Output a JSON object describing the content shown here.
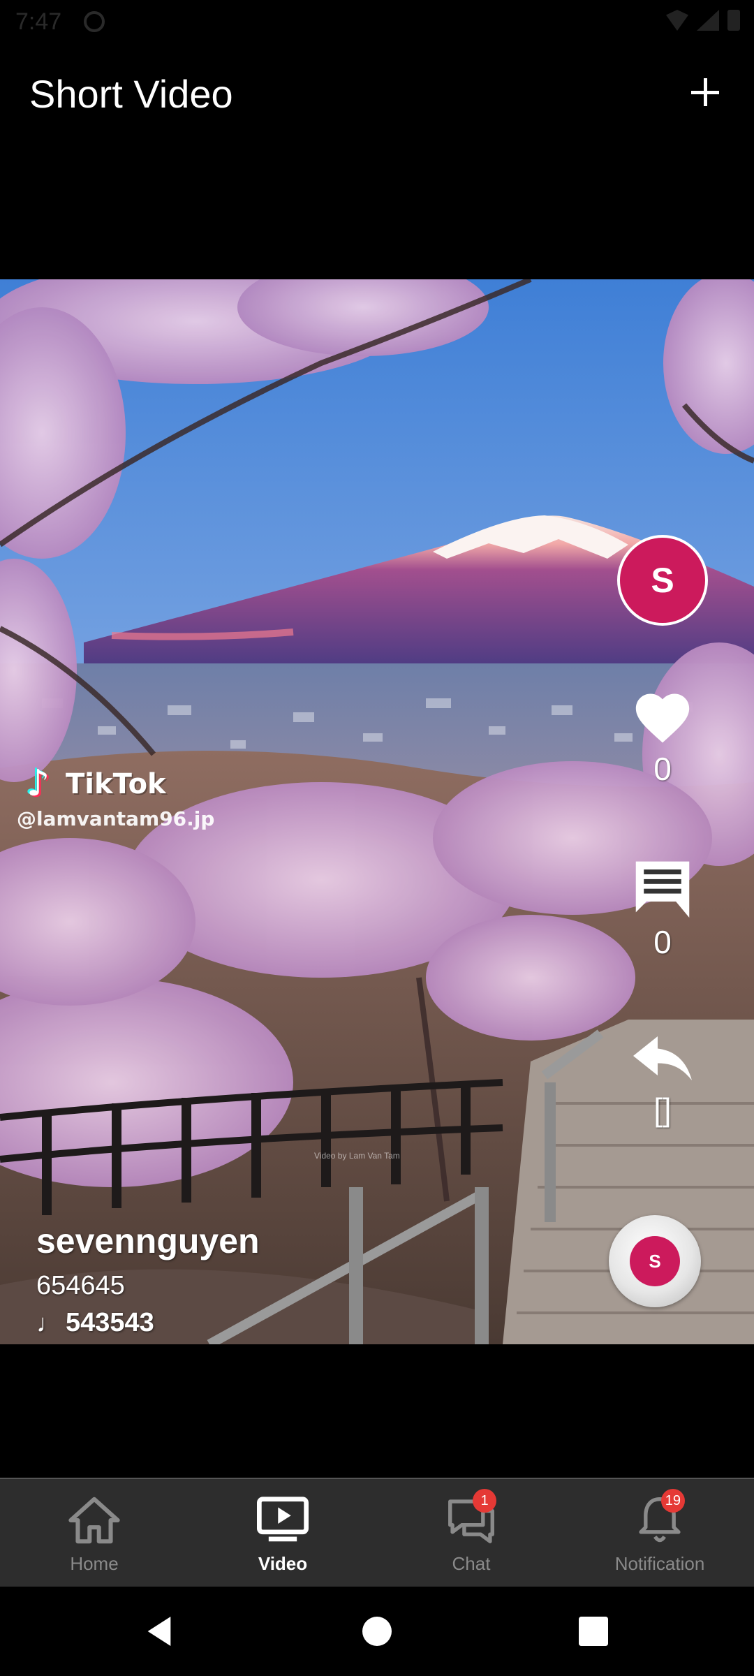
{
  "status_bar": {
    "time": "7:47"
  },
  "header": {
    "title": "Short Video"
  },
  "video": {
    "watermark_brand": "TikTok",
    "watermark_handle": "@lamvantam96.jp",
    "credit": "Video by Lam Van Tam"
  },
  "actions": {
    "avatar_letter": "S",
    "like_count": "0",
    "comment_count": "0",
    "share_count": "[]",
    "disc_letter": "S"
  },
  "caption": {
    "username": "sevennguyen",
    "description": "654645",
    "music": "543543"
  },
  "bottom_nav": {
    "items": [
      {
        "label": "Home",
        "icon": "home-icon",
        "active": false
      },
      {
        "label": "Video",
        "icon": "video-icon",
        "active": true
      },
      {
        "label": "Chat",
        "icon": "chat-icon",
        "active": false,
        "badge": "1"
      },
      {
        "label": "Notification",
        "icon": "bell-icon",
        "active": false,
        "badge": "19"
      }
    ]
  },
  "colors": {
    "accent": "#CC1A5C",
    "nav_background": "#2D2D2D",
    "badge": "#E53935",
    "inactive_label": "#8A8A8A"
  }
}
